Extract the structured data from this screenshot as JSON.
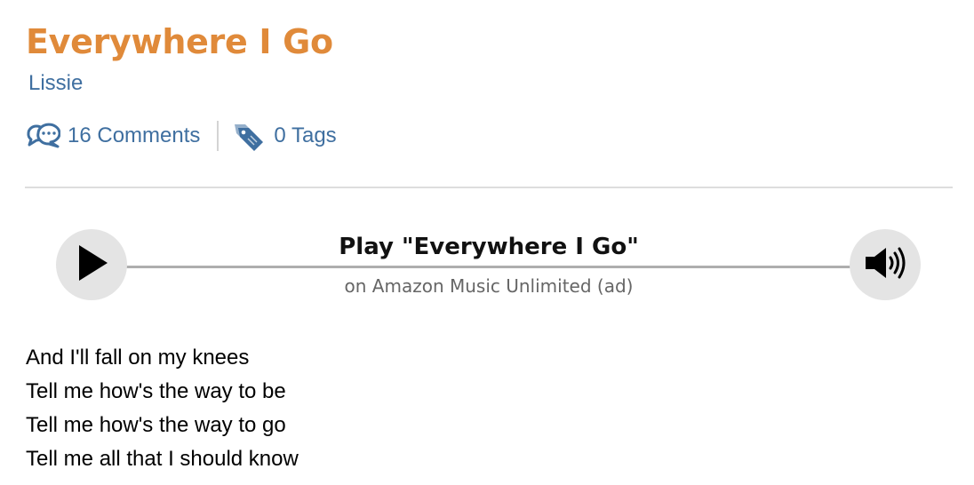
{
  "song": {
    "title": "Everywhere I Go",
    "artist": "Lissie"
  },
  "meta": {
    "comments_label": "16 Comments",
    "tags_label": "0 Tags"
  },
  "player": {
    "title": "Play \"Everywhere I Go\"",
    "subtitle": "on Amazon Music Unlimited (ad)",
    "play_icon": "play-icon",
    "volume_icon": "volume-icon"
  },
  "lyrics": [
    "And I'll fall on my knees",
    "Tell me how's the way to be",
    "Tell me how's the way to go",
    "Tell me all that I should know"
  ],
  "colors": {
    "title": "#e08a3a",
    "link": "#3f6fa0"
  }
}
